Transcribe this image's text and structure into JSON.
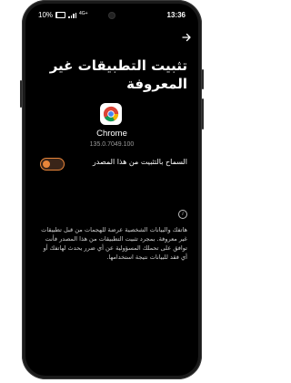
{
  "status_bar": {
    "time": "13:36",
    "battery": "10%",
    "battery_fraction": 0.1,
    "network": "4G+"
  },
  "icons": {
    "back": "arrow-icon",
    "app": "chrome-icon",
    "info": "info-icon"
  },
  "page": {
    "title": "تثبيت التطبيقات غير المعروفة"
  },
  "app": {
    "name": "Chrome",
    "version": "135.0.7049.100"
  },
  "setting": {
    "label": "السماح بالتثبيت من هذا المصدر",
    "enabled": false,
    "accent_color": "#e8853a"
  },
  "warning": {
    "text": "هاتفك والبيانات الشخصية عرضة للهجمات من قبل تطبيقات غير معروفة. بمجرد تثبيت التطبيقات من هذا المصدر فأنت توافق على تحملك المسؤولية عن أي ضرر يحدث لهاتفك أو أي فقد للبيانات نتيجة استخدامها."
  }
}
